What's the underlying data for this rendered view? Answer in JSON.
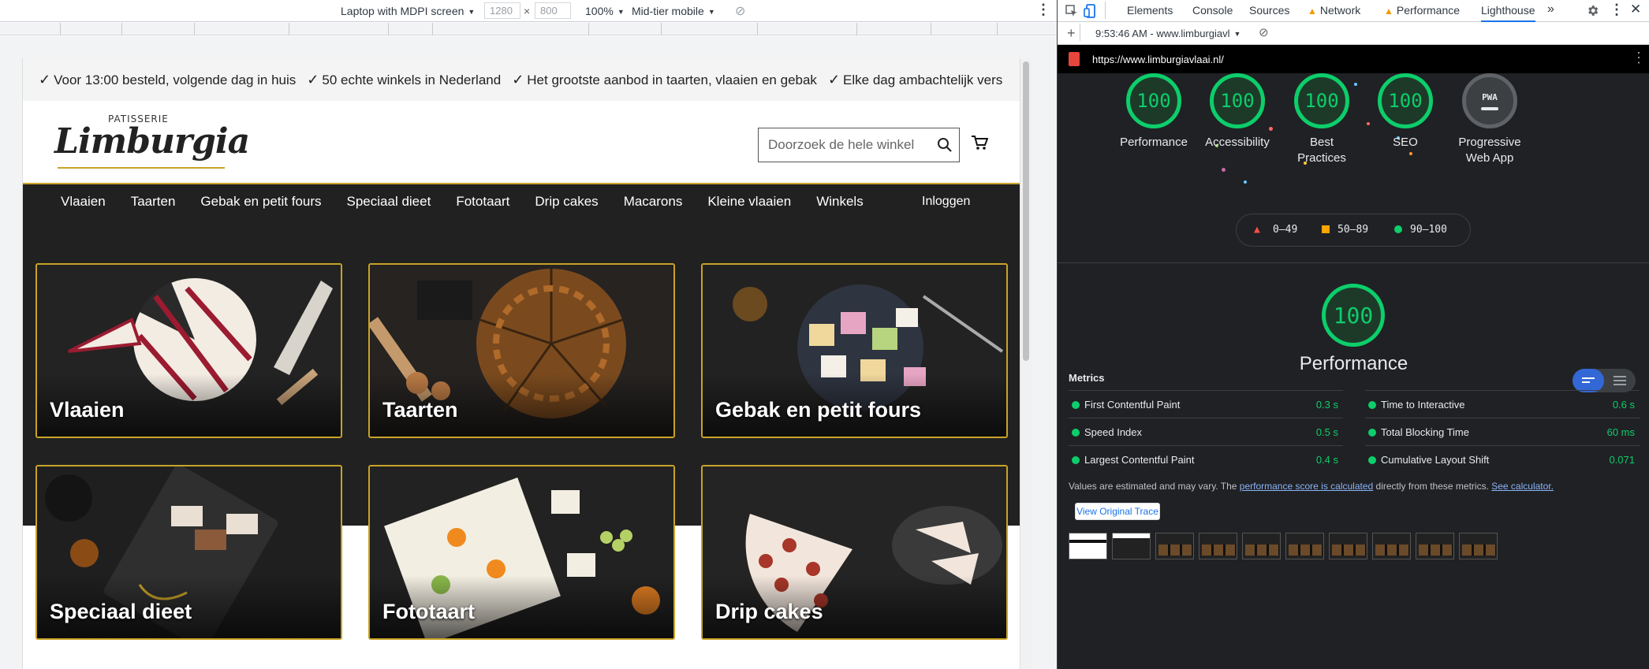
{
  "device_toolbar": {
    "device": "Laptop with MDPI screen",
    "width": "1280",
    "height": "800",
    "times": "×",
    "zoom": "100%",
    "throttle": "Mid-tier mobile"
  },
  "devtools": {
    "tabs": [
      "Elements",
      "Console",
      "Sources",
      "Network",
      "Performance",
      "Lighthouse"
    ],
    "more": "»",
    "report_time": "9:53:46 AM - www.limburgiavl",
    "url": "https://www.limburgiavlaai.nl/"
  },
  "site": {
    "usps": [
      "Voor 13:00 besteld, volgende dag in huis",
      "50 echte winkels in Nederland",
      "Het grootste aanbod in taarten, vlaaien en gebak",
      "Elke dag ambachtelijk vers"
    ],
    "logo_top": "PATISSERIE",
    "logo_name": "Limburgia",
    "search_placeholder": "Doorzoek de hele winkel",
    "nav": [
      "Vlaaien",
      "Taarten",
      "Gebak en petit fours",
      "Speciaal dieet",
      "Fototaart",
      "Drip cakes",
      "Macarons",
      "Kleine vlaaien",
      "Winkels"
    ],
    "login": "Inloggen",
    "categories": [
      "Vlaaien",
      "Taarten",
      "Gebak en petit fours",
      "Speciaal dieet",
      "Fototaart",
      "Drip cakes"
    ]
  },
  "lighthouse": {
    "gauges": [
      {
        "score": "100",
        "label": "Performance"
      },
      {
        "score": "100",
        "label": "Accessibility"
      },
      {
        "score": "100",
        "label": "Best\nPractices"
      },
      {
        "score": "100",
        "label": "SEO"
      }
    ],
    "pwa": {
      "badge": "PWA",
      "label": "Progressive\nWeb App"
    },
    "legend": [
      "0–49",
      "50–89",
      "90–100"
    ],
    "main_score": "100",
    "main_title": "Performance",
    "metrics_heading": "Metrics",
    "metrics": [
      {
        "name": "First Contentful Paint",
        "value": "0.3 s"
      },
      {
        "name": "Time to Interactive",
        "value": "0.6 s"
      },
      {
        "name": "Speed Index",
        "value": "0.5 s"
      },
      {
        "name": "Total Blocking Time",
        "value": "60 ms"
      },
      {
        "name": "Largest Contentful Paint",
        "value": "0.4 s"
      },
      {
        "name": "Cumulative Layout Shift",
        "value": "0.071"
      }
    ],
    "note_start": "Values are estimated and may vary. The ",
    "note_link": "performance score is calculated",
    "note_mid": " directly from these metrics. ",
    "note_link2": "See calculator.",
    "trace_button": "View Original Trace",
    "colors": {
      "pass": "#0cce6b",
      "average": "#ffa400",
      "fail": "#ff4e42",
      "accent": "#c9a227"
    }
  }
}
